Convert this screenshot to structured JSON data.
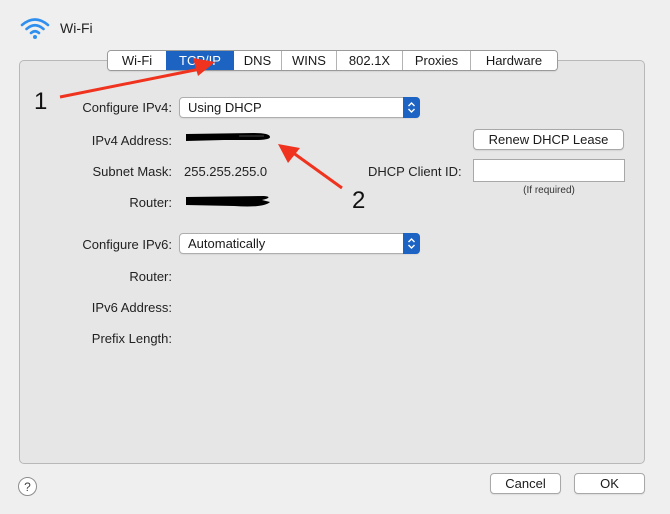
{
  "header": {
    "title": "Wi-Fi",
    "icon": "wifi-icon"
  },
  "tabs": [
    {
      "label": "Wi-Fi",
      "active": false
    },
    {
      "label": "TCP/IP",
      "active": true
    },
    {
      "label": "DNS",
      "active": false
    },
    {
      "label": "WINS",
      "active": false
    },
    {
      "label": "802.1X",
      "active": false
    },
    {
      "label": "Proxies",
      "active": false
    },
    {
      "label": "Hardware",
      "active": false
    }
  ],
  "ipv4": {
    "configure_label": "Configure IPv4:",
    "configure_value": "Using DHCP",
    "address_label": "IPv4 Address:",
    "address_value": "[redacted]",
    "subnet_label": "Subnet Mask:",
    "subnet_value": "255.255.255.0",
    "router_label": "Router:",
    "router_value": "[redacted]",
    "renew_button": "Renew DHCP Lease",
    "client_id_label": "DHCP Client ID:",
    "client_id_value": "",
    "client_id_hint": "(If required)"
  },
  "ipv6": {
    "configure_label": "Configure IPv6:",
    "configure_value": "Automatically",
    "router_label": "Router:",
    "router_value": "",
    "address_label": "IPv6 Address:",
    "address_value": "",
    "prefix_label": "Prefix Length:",
    "prefix_value": ""
  },
  "footer": {
    "help_label": "?",
    "cancel_button": "Cancel",
    "ok_button": "OK"
  },
  "annotations": [
    {
      "number": "1",
      "target": "TCP/IP tab"
    },
    {
      "number": "2",
      "target": "IPv4 Address"
    }
  ],
  "colors": {
    "accent": "#1c63c2",
    "arrow": "#f0331f",
    "panel": "#e6e6e6",
    "window": "#efefef"
  }
}
